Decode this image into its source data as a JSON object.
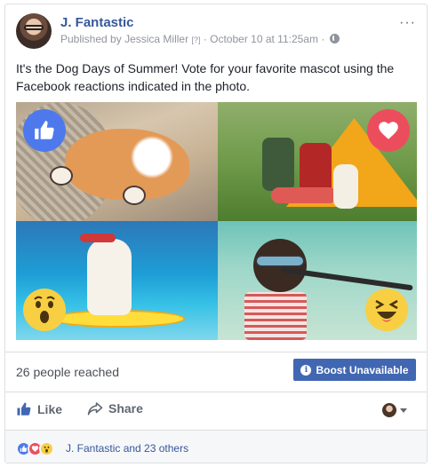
{
  "post": {
    "author": "J. Fantastic",
    "published_by_prefix": "Published by",
    "publisher": "Jessica Miller",
    "publisher_marker": "[?]",
    "date": "October 10 at 11:25am",
    "separator": "·",
    "privacy_icon": "globe-icon",
    "more_options": "···",
    "text": "It's the Dog Days of Summer! Vote for your favorite mascot using the Facebook reactions indicated in the photo."
  },
  "photos": [
    {
      "subject": "sleeping-shiba-puppy",
      "reaction": "like",
      "reaction_color": "#4d79ec"
    },
    {
      "subject": "terrier-camping-tent",
      "reaction": "love",
      "reaction_color": "#ec4d5c"
    },
    {
      "subject": "dog-surfboard-sunglasses",
      "reaction": "wow",
      "reaction_color": "#f8cf43"
    },
    {
      "subject": "dog-bicycle-goggles",
      "reaction": "haha",
      "reaction_color": "#f8cf43"
    }
  ],
  "insights": {
    "reach_text": "26 people reached",
    "boost_label": "Boost Unavailable",
    "boost_icon": "info-icon",
    "boost_icon_glyph": "i",
    "boost_color": "#4267b2"
  },
  "actions": {
    "like_label": "Like",
    "share_label": "Share"
  },
  "reactions_summary": {
    "text": "J. Fantastic and 23 others",
    "icons": [
      "like",
      "love",
      "wow"
    ]
  },
  "colors": {
    "link_blue": "#365899",
    "meta_gray": "#90949c"
  }
}
